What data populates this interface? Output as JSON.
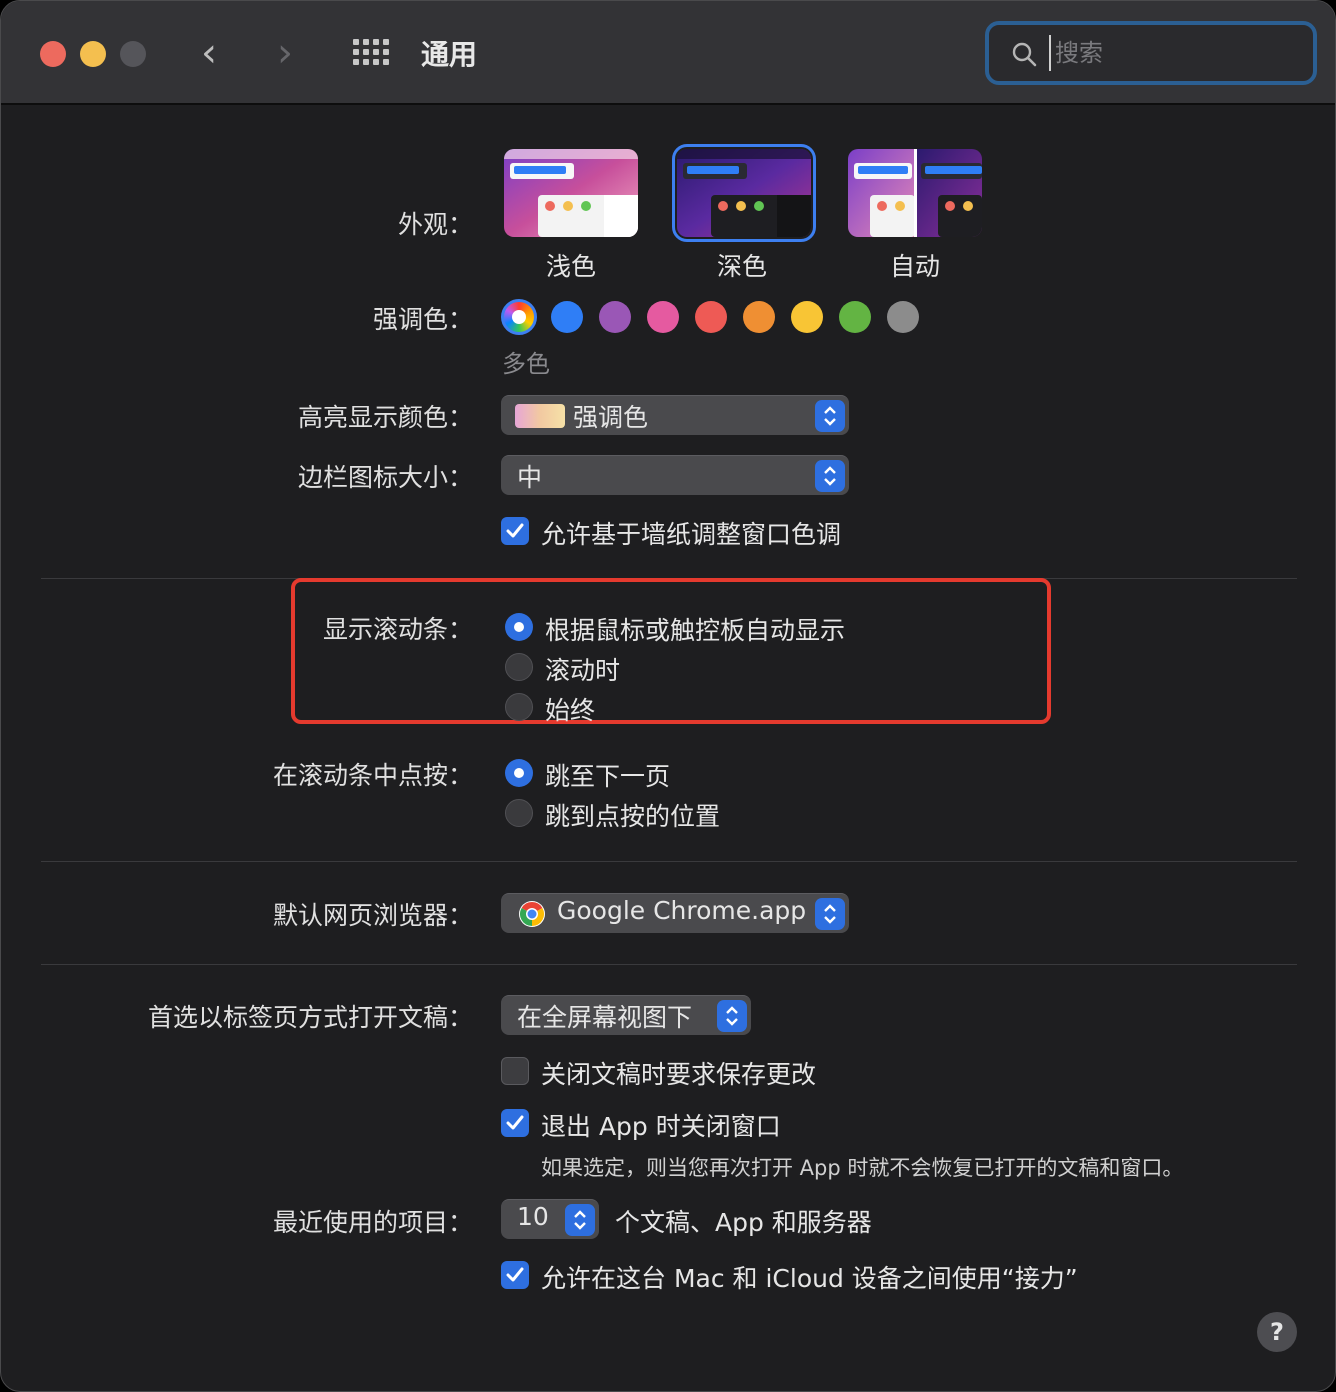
{
  "window": {
    "title": "通用"
  },
  "search": {
    "placeholder": "搜索"
  },
  "appearance": {
    "label": "外观：",
    "options": [
      {
        "label": "浅色",
        "selected": false
      },
      {
        "label": "深色",
        "selected": true
      },
      {
        "label": "自动",
        "selected": false
      }
    ]
  },
  "accent": {
    "label": "强调色：",
    "selected_name": "多色",
    "colors": [
      "multicolor",
      "#2f7ef6",
      "#9a57b6",
      "#e55aa0",
      "#ee5a55",
      "#ef8f33",
      "#f8c535",
      "#63b443",
      "#8c8c8c"
    ]
  },
  "highlight": {
    "label": "高亮显示颜色：",
    "value": "强调色"
  },
  "sidebar_icon": {
    "label": "边栏图标大小：",
    "value": "中"
  },
  "wallpaper_tint": {
    "label": "允许基于墙纸调整窗口色调",
    "checked": true
  },
  "show_scrollbars": {
    "label": "显示滚动条：",
    "options": [
      {
        "label": "根据鼠标或触控板自动显示",
        "selected": true
      },
      {
        "label": "滚动时",
        "selected": false
      },
      {
        "label": "始终",
        "selected": false
      }
    ]
  },
  "click_scrollbar": {
    "label": "在滚动条中点按：",
    "options": [
      {
        "label": "跳至下一页",
        "selected": true
      },
      {
        "label": "跳到点按的位置",
        "selected": false
      }
    ]
  },
  "default_browser": {
    "label": "默认网页浏览器：",
    "value": "Google Chrome.app"
  },
  "prefer_tabs": {
    "label": "首选以标签页方式打开文稿：",
    "value": "在全屏幕视图下"
  },
  "ask_save": {
    "label": "关闭文稿时要求保存更改",
    "checked": false
  },
  "close_windows": {
    "label": "退出 App 时关闭窗口",
    "checked": true,
    "note": "如果选定，则当您再次打开 App 时就不会恢复已打开的文稿和窗口。"
  },
  "recent_items": {
    "label": "最近使用的项目：",
    "value": "10",
    "suffix": "个文稿、App 和服务器"
  },
  "handoff": {
    "label": "允许在这台 Mac 和 iCloud 设备之间使用“接力”",
    "checked": true
  },
  "help": {
    "label": "?"
  },
  "colors": {
    "accent_blue": "#2e6fe0",
    "highlight_red": "#e53a2e",
    "window_bg": "#1e1e20"
  }
}
